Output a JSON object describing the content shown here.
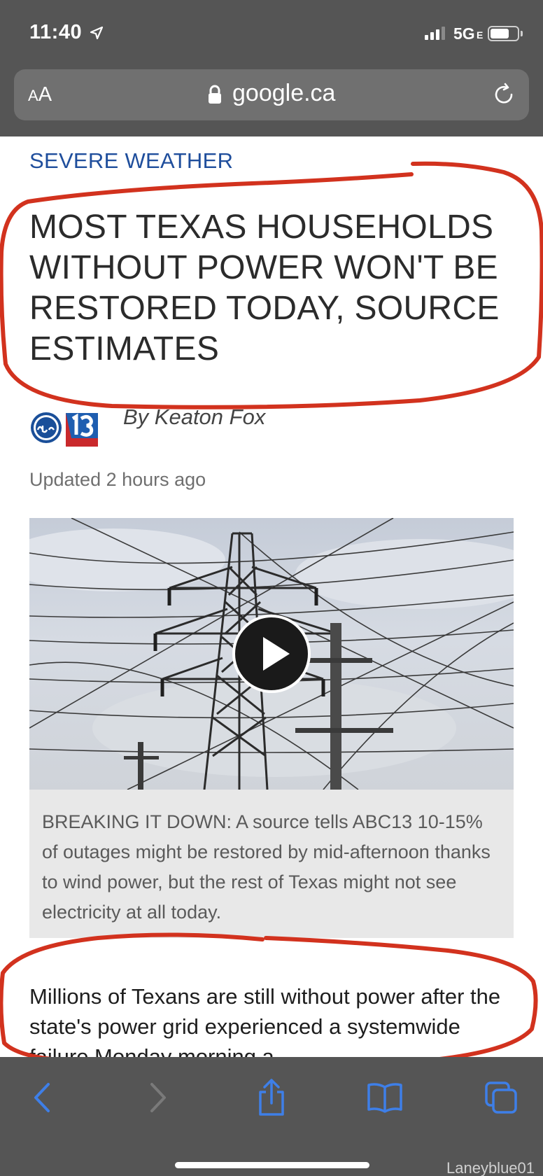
{
  "status_bar": {
    "time": "11:40",
    "network": "5G",
    "network_sub": "E"
  },
  "browser": {
    "text_size_small": "A",
    "text_size_big": "A",
    "url": "google.ca"
  },
  "article": {
    "section": "SEVERE WEATHER",
    "headline": "MOST TEXAS HOUSEHOLDS WITHOUT POWER WON'T BE RESTORED TODAY, SOURCE ESTIMATES",
    "logo_text": "abc13",
    "byline": "By Keaton Fox",
    "updated": "Updated 2 hours ago",
    "video_caption": "BREAKING IT DOWN: A source tells ABC13 10-15% of outages might be restored by mid-afternoon thanks to wind power, but the rest of Texas might not see electricity at all today.",
    "body": "Millions of Texans are still without power after the state's power grid experienced a systemwide failure Monday morning a"
  },
  "annotation_color": "#d2321e",
  "watermark": "Laneyblue01",
  "colors": {
    "chrome_bg": "#555555",
    "section_label": "#1f4e9c",
    "toolbar_icon": "#3e7fe8"
  }
}
